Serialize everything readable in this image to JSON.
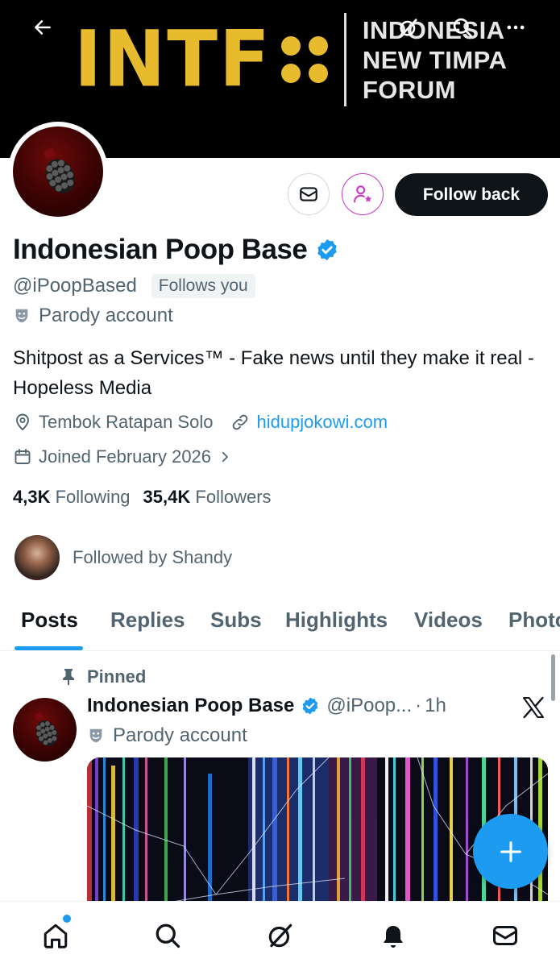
{
  "banner": {
    "logo_text": "INTF",
    "logo_words": [
      "INDONESIA",
      "NEW TIMPA",
      "FORUM"
    ]
  },
  "header": {
    "back_icon": "arrow-left-icon",
    "grok_icon": "grok-icon",
    "search_icon": "search-icon",
    "more_icon": "more-icon"
  },
  "actions": {
    "message_icon": "mail-icon",
    "subscribe_icon": "person-star-icon",
    "follow_label": "Follow back"
  },
  "profile": {
    "name": "Indonesian Poop Base",
    "handle": "@iPoopBased",
    "follows_you": "Follows you",
    "parody_label": "Parody account",
    "bio": "Shitpost as a Services™ - Fake news until they make it real - Hopeless Media",
    "location": "Tembok Ratapan Solo",
    "website": "hidupjokowi.com",
    "joined": "Joined February 2026",
    "following_count": "4,3K",
    "following_label": "Following",
    "followers_count": "35,4K",
    "followers_label": "Followers",
    "followed_by": "Followed by Shandy"
  },
  "tabs": [
    "Posts",
    "Replies",
    "Subs",
    "Highlights",
    "Videos",
    "Photos"
  ],
  "active_tab": "Posts",
  "pinned_post": {
    "pinned_label": "Pinned",
    "author_name": "Indonesian Poop Base",
    "author_handle": "@iPoop...",
    "separator": "·",
    "time": "1h",
    "parody_label": "Parody account"
  },
  "bottom_nav": [
    "home-icon",
    "search-icon",
    "grok-icon",
    "notifications-icon",
    "messages-icon"
  ],
  "colors": {
    "accent": "#1d9bf0",
    "logo_gold": "#e8bb2e",
    "subscribe_purple": "#c936c9",
    "text_primary": "#0f1419",
    "text_secondary": "#536471"
  }
}
